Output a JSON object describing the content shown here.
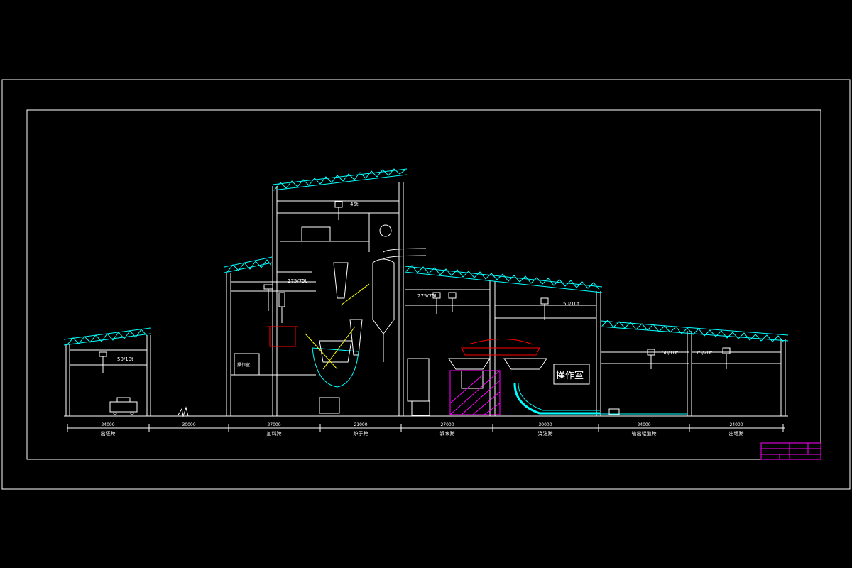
{
  "drawing": {
    "background": "#000000",
    "line_color": "#ffffff",
    "truss_color": "#00ffff",
    "accent_red": "#ff0000",
    "accent_magenta": "#ff00ff",
    "accent_yellow": "#ffff00",
    "accent_blue": "#3333ff",
    "room_label_large": "操作室",
    "room_label_small": "操作室",
    "crane_labels": [
      "50/10t",
      "275/75t",
      "45t",
      "275/75t",
      "50/10t",
      "50/10t",
      "75/20t"
    ],
    "bay_spans": [
      "24000",
      "30000",
      "27000",
      "21000",
      "27000",
      "30000",
      "24000",
      "24000"
    ],
    "bay_names": [
      "出坯跨",
      "",
      "加料跨",
      "炉子跨",
      "钢水跨",
      "浇注跨",
      "输出辊道跨",
      "出坯跨"
    ]
  }
}
